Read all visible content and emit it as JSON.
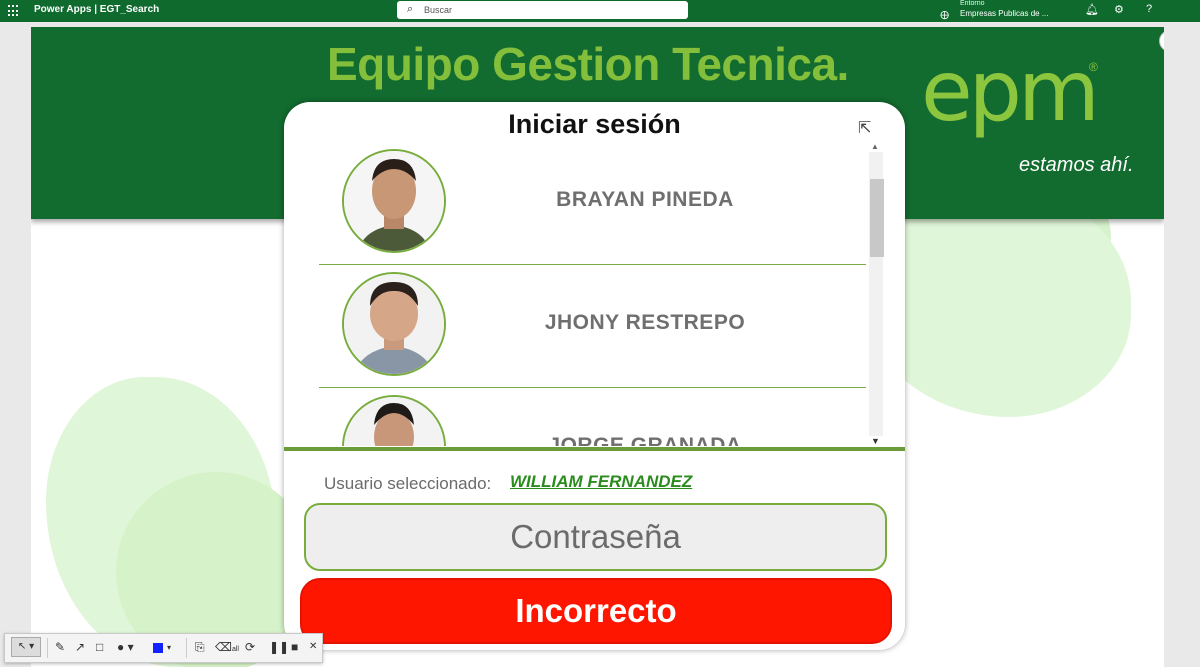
{
  "topbar": {
    "app_title": "Power Apps  |  EGT_Search",
    "search_placeholder": "Buscar",
    "environment_label": "Entorno",
    "environment_value": "Empresas Publicas de ...",
    "icons": [
      "app-launcher-icon",
      "search-icon",
      "environment-icon",
      "bell-icon",
      "gear-icon",
      "help-icon"
    ]
  },
  "header": {
    "title": "Equipo Gestion Tecnica.",
    "logo": "epm",
    "logo_registered": "®",
    "tagline": "estamos ahí."
  },
  "dialog": {
    "title": "Iniciar sesión",
    "users": [
      {
        "name": "BRAYAN PINEDA"
      },
      {
        "name": "JHONY RESTREPO"
      },
      {
        "name": "JORGE GRANADA"
      }
    ],
    "selected_label": "Usuario seleccionado:",
    "selected_value": "WILLIAM FERNANDEZ",
    "password_placeholder": "Contraseña",
    "status_button": "Incorrecto"
  },
  "colors": {
    "header_green": "#126b2f",
    "brand_green": "#84bf3c",
    "error_red": "#ff1600",
    "link_green": "#2b8c1e"
  },
  "annotation_toolbar": {
    "erase_all_label": "all"
  }
}
